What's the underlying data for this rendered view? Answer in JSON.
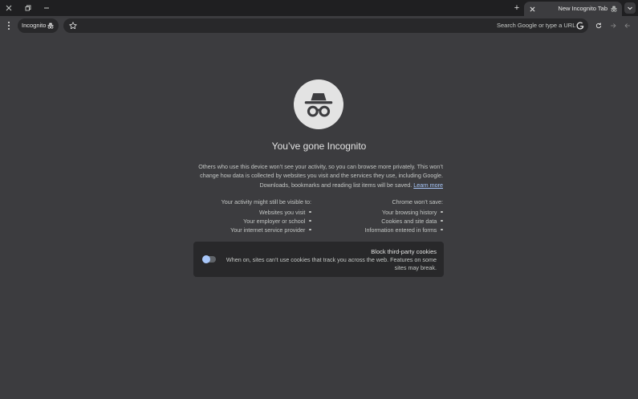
{
  "tabstrip": {
    "tab_title": "New Incognito Tab",
    "new_tab_symbol": "+"
  },
  "toolbar": {
    "incognito_label": "Incognito",
    "omnibox_placeholder": "Search Google or type a URL"
  },
  "page": {
    "heading": "You’ve gone Incognito",
    "intro": "Others who use this device won’t see your activity, so you can browse more privately. This won’t change how data is collected by websites you visit and the services they use, including Google. Downloads, bookmarks and reading list items will be saved.",
    "learn_more": "Learn more",
    "wont_save": {
      "title": "Chrome won’t save:",
      "items": [
        "Your browsing history",
        "Cookies and site data",
        "Information entered in forms"
      ]
    },
    "might_be_visible": {
      "title": "Your activity might still be visible to:",
      "items": [
        "Websites you visit",
        "Your employer or school",
        "Your internet service provider"
      ]
    },
    "cookie_card": {
      "title": "Block third-party cookies",
      "description": "When on, sites can’t use cookies that track you across the web. Features on some sites may break.",
      "toggle_on": false
    }
  },
  "colors": {
    "background": "#3c3c3f",
    "tabstrip": "#1f1f21",
    "surface": "#28282a",
    "text": "#e3e3e3",
    "secondary_text": "#c4c7c5",
    "link": "#a8c7fa"
  },
  "icons": {
    "window": [
      "close-icon",
      "restore-icon",
      "minimize-icon"
    ],
    "tab": [
      "close-icon",
      "incognito-icon"
    ],
    "toolbar": [
      "menu-icon",
      "incognito-icon",
      "star-icon",
      "google-g-icon",
      "reload-icon",
      "forward-icon",
      "back-icon"
    ],
    "hero": "incognito-icon"
  }
}
